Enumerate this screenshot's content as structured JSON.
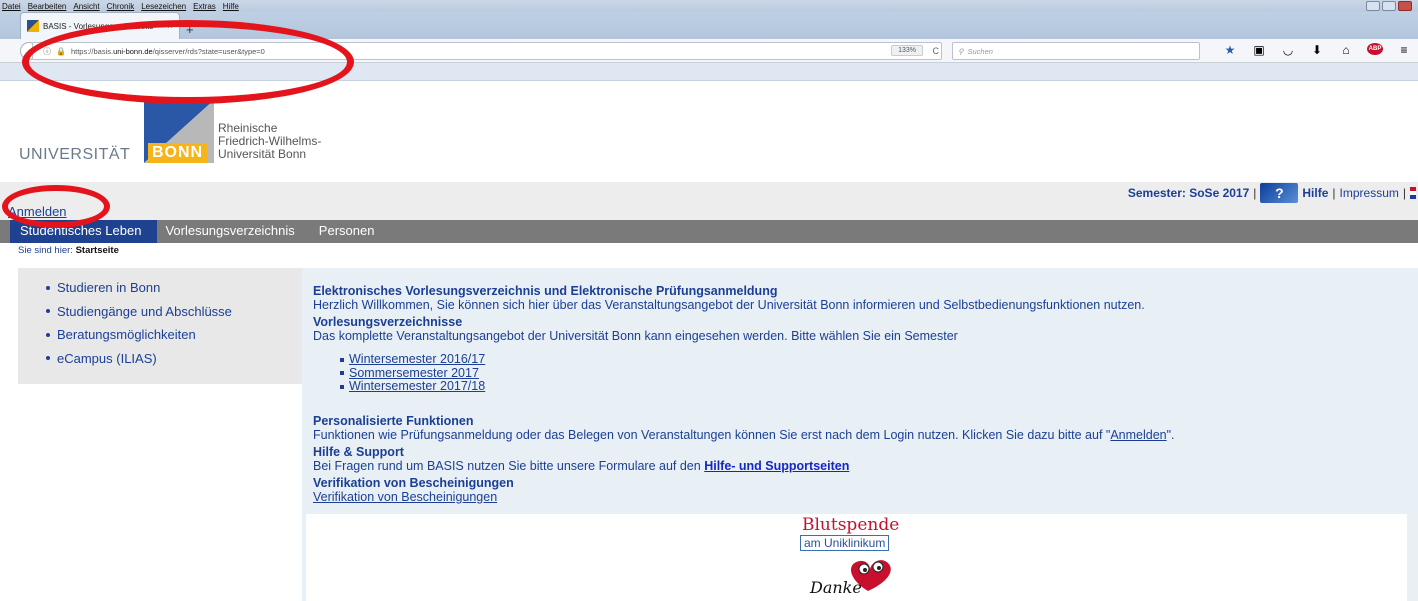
{
  "browser": {
    "menu": [
      "Datei",
      "Bearbeiten",
      "Ansicht",
      "Chronik",
      "Lesezeichen",
      "Extras",
      "Hilfe"
    ],
    "tab_title": "BASIS - Vorlesungsverzeichnis",
    "tab_close": "×",
    "new_tab": "+",
    "url_prefix": "https://basis.",
    "url_domain": "uni-bonn.de",
    "url_path": "/qisserver/rds?state=user&type=0",
    "zoom": "133%",
    "reload": "C",
    "search_placeholder": "Suchen",
    "toolbar_icons": [
      "star-icon",
      "library-icon",
      "pocket-icon",
      "download-icon",
      "home-icon",
      "adblock-icon",
      "menu-icon"
    ],
    "abp_label": "ABP"
  },
  "logo": {
    "university": "UNIVERSITÄT",
    "bonn": "BONN",
    "line1": "Rheinische",
    "line2": "Friedrich-Wilhelms-",
    "line3": "Universität Bonn"
  },
  "topbar": {
    "login": "Anmelden",
    "semester": "Semester: SoSe 2017",
    "help_icon": "?",
    "help": "Hilfe",
    "impressum": "Impressum",
    "separator": "|"
  },
  "nav": {
    "items": [
      "Studentisches Leben",
      "Vorlesungsverzeichnis",
      "Personen"
    ]
  },
  "breadcrumb": {
    "prefix": "Sie sind hier:",
    "current": "Startseite"
  },
  "sidebar": {
    "items": [
      "Studieren in Bonn",
      "Studiengänge und Abschlüsse",
      "Beratungsmöglichkeiten",
      "eCampus (ILIAS)"
    ]
  },
  "content": {
    "h1": "Elektronisches Vorlesungsverzeichnis und Elektronische Prüfungsanmeldung",
    "p1": "Herzlich Willkommen, Sie können sich hier über das Veranstaltungsangebot der Universität Bonn informieren und Selbstbedienungsfunktionen nutzen.",
    "h2": "Vorlesungsverzeichnisse",
    "p2": "Das komplette Veranstaltungsangebot der Universität Bonn kann eingesehen werden. Bitte wählen Sie ein Semester",
    "semesters": [
      "Wintersemester 2016/17",
      "Sommersemester 2017",
      "Wintersemester 2017/18"
    ],
    "h3": "Personalisierte Funktionen",
    "p3_before": "Funktionen wie Prüfungsanmeldung oder das Belegen von Veranstaltungen können Sie erst nach dem Login nutzen. Klicken Sie dazu bitte auf \"",
    "p3_link": "Anmelden",
    "p3_after": "\".",
    "h4": "Hilfe & Support",
    "p4_before": "Bei Fragen rund um BASIS nutzen Sie bitte unsere Formulare auf den ",
    "p4_link": "Hilfe- und Supportseiten",
    "h5": "Verifikation von Bescheinigungen",
    "p5_link": "Verifikation von Bescheinigungen"
  },
  "banner": {
    "title": "Blutspende",
    "subtitle": "am Uniklinikum",
    "danke": "Danke"
  },
  "colors": {
    "accent": "#1c3f95",
    "nav_bg": "#7a7a7a",
    "nav_active": "#1e4190",
    "annotation": "#e4141c",
    "bonn_yellow": "#f4b41a"
  }
}
